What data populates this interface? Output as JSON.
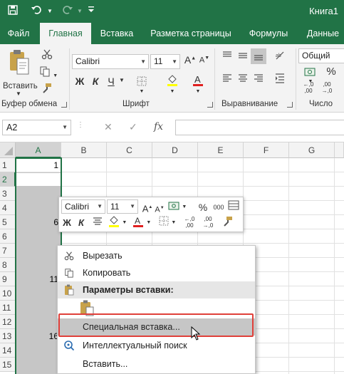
{
  "title_bar": {
    "workbook_title": "Книга1",
    "quick_access": [
      "save-icon",
      "undo-icon",
      "redo-icon",
      "customize-icon"
    ]
  },
  "tabs": [
    "Файл",
    "Главная",
    "Вставка",
    "Разметка страницы",
    "Формулы",
    "Данные"
  ],
  "active_tab": "Главная",
  "ribbon": {
    "clipboard": {
      "paste_label": "Вставить",
      "group_label": "Буфер обмена"
    },
    "font": {
      "name": "Calibri",
      "size": "11",
      "group_label": "Шрифт",
      "bold": "Ж",
      "italic": "К",
      "underline": "Ч"
    },
    "alignment": {
      "group_label": "Выравнивание"
    },
    "number": {
      "format": "Общий",
      "group_label": "Число"
    }
  },
  "formula_bar": {
    "name_box": "A2",
    "fx": "fx",
    "value": ""
  },
  "columns": [
    "A",
    "B",
    "C",
    "D",
    "E",
    "F",
    "G"
  ],
  "rows": [
    "1",
    "2",
    "3",
    "4",
    "5",
    "6",
    "7",
    "8",
    "9",
    "10",
    "11",
    "12",
    "13",
    "14",
    "15"
  ],
  "cell_values": {
    "A1": "1",
    "A5": "6",
    "A9": "11",
    "A13": "16"
  },
  "mini_toolbar": {
    "font": "Calibri",
    "size": "11",
    "percent": "%",
    "thousands": "000",
    "bold": "Ж",
    "italic": "К"
  },
  "context_menu": {
    "cut": "Вырезать",
    "copy": "Копировать",
    "paste_options_header": "Параметры вставки:",
    "special_paste": "Специальная вставка...",
    "smart_lookup": "Интеллектуальный поиск",
    "insert": "Вставить..."
  },
  "colors": {
    "excel_green": "#217346",
    "highlight_frame": "#e0403a"
  }
}
